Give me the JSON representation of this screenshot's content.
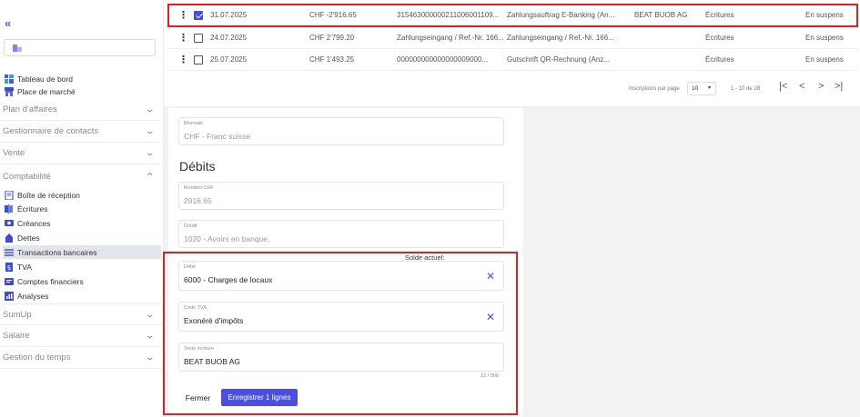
{
  "sidebar": {
    "collapse_label": "«",
    "top_items": [
      {
        "label": "Tableau de bord",
        "icon": "dashboard-icon"
      },
      {
        "label": "Place de marché",
        "icon": "store-icon"
      }
    ],
    "sections": [
      {
        "label": "Plan d'affaires"
      },
      {
        "label": "Gestionnaire de contacts"
      },
      {
        "label": "Vente"
      },
      {
        "label": "Comptabilité"
      }
    ],
    "comptabilite_items": [
      {
        "label": "Boîte de réception",
        "icon": "inbox-icon"
      },
      {
        "label": "Écritures",
        "icon": "book-icon"
      },
      {
        "label": "Créances",
        "icon": "receivables-icon"
      },
      {
        "label": "Dettes",
        "icon": "debts-icon"
      },
      {
        "label": "Transactions bancaires",
        "icon": "bank-transactions-icon"
      },
      {
        "label": "TVA",
        "icon": "tax-icon"
      },
      {
        "label": "Comptes financiers",
        "icon": "accounts-icon"
      },
      {
        "label": "Analyses",
        "icon": "analytics-icon"
      }
    ],
    "lower_sections": [
      {
        "label": "SumUp"
      },
      {
        "label": "Salaire"
      },
      {
        "label": "Gestion du temps"
      }
    ]
  },
  "table": {
    "rows": [
      {
        "date": "31.07.2025",
        "amount": "CHF -2'916.65",
        "reference": "315463000000211006001109...",
        "text": "Zahlungsauftrag E-Banking (An...",
        "partner": "BEAT BUOB AG",
        "type": "Écritures",
        "status": "En suspens",
        "checked": true
      },
      {
        "date": "24.07.2025",
        "amount": "CHF 2'799.20",
        "reference": "Zahlungseingang / Ref.-Nr. 166...",
        "text": "Zahlungseingang / Ref.-Nr. 166...",
        "partner": "",
        "type": "Écritures",
        "status": "En suspens",
        "checked": false
      },
      {
        "date": "25.07.2025",
        "amount": "CHF 1'493.25",
        "reference": "000000000000000009000...",
        "text": "Gutschrift QR-Rechnung (Anz...",
        "partner": "",
        "type": "Écritures",
        "status": "En suspens",
        "checked": false
      }
    ],
    "pager": {
      "per_page_label": "Inscriptions par page",
      "per_page_value": "10",
      "range": "1 - 10 de 28",
      "first": "|<",
      "prev": "<",
      "next": ">",
      "last": ">|"
    }
  },
  "form": {
    "currency": {
      "label": "Monnaie",
      "value": "CHF - Franc suisse"
    },
    "debits_title": "Débits",
    "amount": {
      "label": "Montant CHF",
      "value": "2916.65"
    },
    "credit": {
      "label": "Crédit",
      "value": "1020 - Avoirs en banque,"
    },
    "solde": "Solde actuel:",
    "debit": {
      "label": "Débit",
      "value": "6000 - Charges de locaux"
    },
    "tax_code": {
      "label": "Code TVA",
      "value": "Exonéré d'impôts"
    },
    "entry_text": {
      "label": "Texte écriture",
      "value": "BEAT BUOB AG"
    },
    "counter": "12 / 500",
    "close_label": "Fermer",
    "save_label": "Enregistrer 1 lignes"
  },
  "colors": {
    "accent": "#4a4fe0",
    "highlight": "#e02020"
  }
}
